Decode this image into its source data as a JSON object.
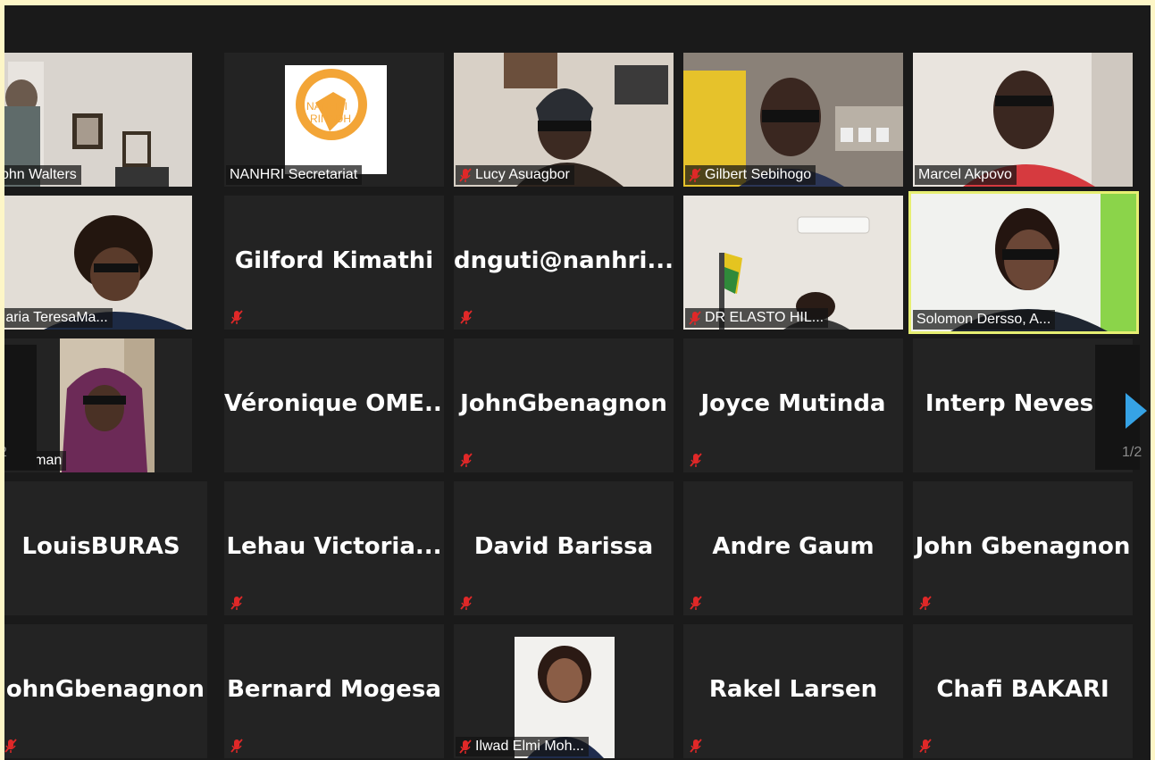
{
  "pagination": {
    "label": "1/2",
    "prev_label": "2"
  },
  "tiles": [
    {
      "name": "John Walters",
      "muted": true,
      "video": "office"
    },
    {
      "name": "NANHRI Secretariat",
      "muted": false,
      "video": "logo"
    },
    {
      "name": "Lucy Asuagbor",
      "muted": true,
      "video": "person"
    },
    {
      "name": "Gilbert Sebihogo",
      "muted": true,
      "video": "person"
    },
    {
      "name": "Marcel Akpovo",
      "muted": false,
      "video": "person"
    },
    {
      "name": "Maria TeresaMa...",
      "muted": true,
      "video": "person"
    },
    {
      "name": "Gilford Kimathi",
      "muted": true,
      "video": "none"
    },
    {
      "name": "dnguti@nanhri....",
      "muted": true,
      "video": "none"
    },
    {
      "name": "DR ELASTO HIL...",
      "muted": true,
      "video": "room"
    },
    {
      "name": "Solomon Dersso, A...",
      "muted": false,
      "video": "person",
      "active": true
    },
    {
      "name": "aweHamman",
      "muted": false,
      "video": "person"
    },
    {
      "name": "Véronique  OME...",
      "muted": false,
      "video": "none"
    },
    {
      "name": "JohnGbenagnon",
      "muted": true,
      "video": "none"
    },
    {
      "name": "Joyce Mutinda",
      "muted": true,
      "video": "none"
    },
    {
      "name": "Interp Neves",
      "muted": false,
      "video": "none"
    },
    {
      "name": "LouisBURAS",
      "muted": false,
      "video": "none"
    },
    {
      "name": "Lehau  Victoria...",
      "muted": true,
      "video": "none"
    },
    {
      "name": "David Barissa",
      "muted": true,
      "video": "none"
    },
    {
      "name": "Andre Gaum",
      "muted": true,
      "video": "none"
    },
    {
      "name": "John Gbenagnon",
      "muted": true,
      "video": "none"
    },
    {
      "name": "JohnGbenagnon",
      "muted": true,
      "video": "none"
    },
    {
      "name": "Bernard Mogesa",
      "muted": true,
      "video": "none"
    },
    {
      "name": "Ilwad Elmi Moh...",
      "muted": true,
      "video": "photo"
    },
    {
      "name": "Rakel Larsen",
      "muted": true,
      "video": "none"
    },
    {
      "name": "Chafi BAKARI",
      "muted": true,
      "video": "none"
    }
  ],
  "colors": {
    "mute_red": "#e02828",
    "active_border": "#e7ef72",
    "arrow": "#36a3e6"
  }
}
